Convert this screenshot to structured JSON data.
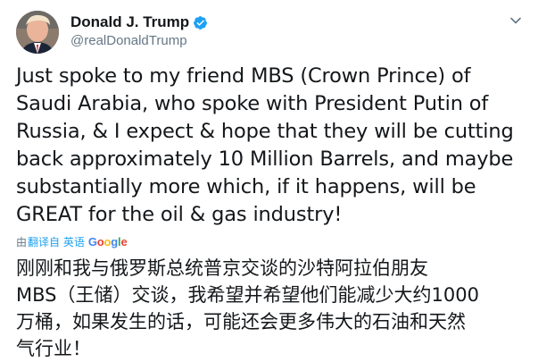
{
  "tweet": {
    "author": {
      "display_name": "Donald J. Trump",
      "handle": "@realDonaldTrump",
      "verified": true
    },
    "text_lines": [
      "Just spoke to my friend MBS (Crown Prince) of",
      "Saudi Arabia, who spoke with President Putin of",
      "Russia, & I expect & hope that they will be cutting",
      "back approximately 10 Million Barrels, and maybe",
      "substantially more which, if it happens, will be",
      "GREAT for the oil & gas industry!"
    ],
    "translation": {
      "prefix": "由",
      "link_label": "翻译自 英语",
      "engine_logo": "Google",
      "logo_colors": [
        "#4285f4",
        "#ea4335",
        "#fbbc05",
        "#4285f4",
        "#34a853",
        "#ea4335"
      ],
      "text_lines": [
        "刚刚和我与俄罗斯总统普京交谈的沙特阿拉伯朋友",
        "MBS（王储）交谈，我希望并希望他们能减少大约1000",
        "万桶，如果发生的话，可能还会更多伟大的石油和天然",
        "气行业！"
      ]
    }
  },
  "icons": {
    "verified": "verified-badge-icon",
    "caret": "chevron-down-icon"
  },
  "colors": {
    "verified_blue": "#1da1f2",
    "link_blue": "#1da1f2",
    "secondary_text": "#657786",
    "primary_text": "#14171a"
  }
}
